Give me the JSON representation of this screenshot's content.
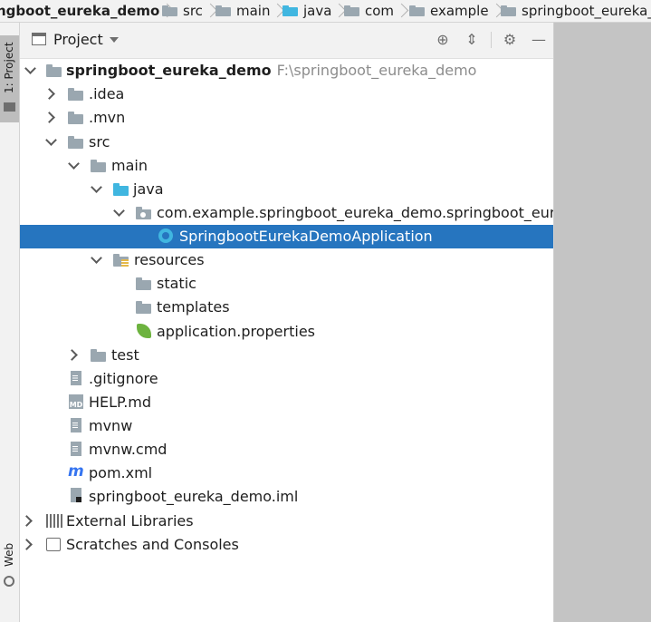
{
  "breadcrumb": [
    "ngboot_eureka_demo",
    "src",
    "main",
    "java",
    "com",
    "example",
    "springboot_eureka_"
  ],
  "side_tabs": {
    "project": "1: Project",
    "web": "Web"
  },
  "panel": {
    "title": "Project",
    "toolbar_icons": [
      "locate-icon",
      "collapse-icon",
      "gear-icon",
      "minimize-icon"
    ]
  },
  "tree": [
    {
      "label": "springboot_eureka_demo",
      "path": "F:\\springboot_eureka_demo"
    },
    {
      "label": ".idea"
    },
    {
      "label": ".mvn"
    },
    {
      "label": "src"
    },
    {
      "label": "main"
    },
    {
      "label": "java"
    },
    {
      "label": "com.example.springboot_eureka_demo.springboot_eureka_"
    },
    {
      "label": "SpringbootEurekaDemoApplication"
    },
    {
      "label": "resources"
    },
    {
      "label": "static"
    },
    {
      "label": "templates"
    },
    {
      "label": "application.properties"
    },
    {
      "label": "test"
    },
    {
      "label": ".gitignore"
    },
    {
      "label": "HELP.md"
    },
    {
      "label": "mvnw"
    },
    {
      "label": "mvnw.cmd"
    },
    {
      "label": "pom.xml"
    },
    {
      "label": "springboot_eureka_demo.iml"
    },
    {
      "label": "External Libraries"
    },
    {
      "label": "Scratches and Consoles"
    }
  ],
  "md_badge": "MD",
  "maven_glyph": "m",
  "colors": {
    "selection": "#2675bf",
    "folder": "#9aa7b0",
    "source_folder": "#40b6e0",
    "spring": "#6db33f"
  }
}
